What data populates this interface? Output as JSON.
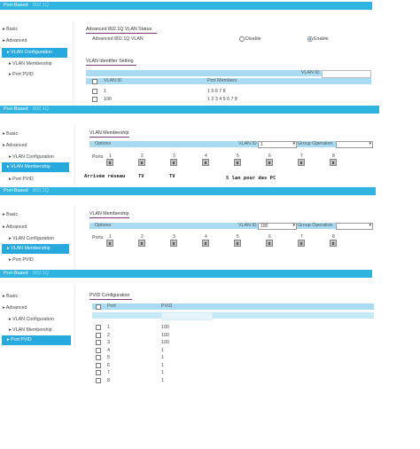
{
  "common": {
    "tab_main": "Port-Based",
    "tab_sub": "802.1Q",
    "nav_basic": "Basic",
    "nav_advanced": "Advanced",
    "nav_vlan_config": "VLAN Configuration",
    "nav_vlan_membership": "VLAN Membership",
    "nav_port_pvid": "Port PVID",
    "bullet": "▸"
  },
  "panel1": {
    "status_title": "Advanced 802.1Q VLAN Status",
    "status_label": "Advanced 802.1Q VLAN",
    "disable_label": "Disable",
    "enable_label": "Enable",
    "selected": "Enable",
    "id_setting_title": "VLAN Identifier Setting",
    "vlan_id_label": "VLAN ID",
    "col_vlan_id": "VLAN ID",
    "col_port_members": "Port Members",
    "rows": [
      {
        "id": "1",
        "members": "1   5 6 7 8"
      },
      {
        "id": "100",
        "members": "1 2 3 4 5 6 7 8"
      }
    ]
  },
  "membership": {
    "title": "VLAN Membership",
    "options_label": "Options",
    "vlan_id_label": "VLAN ID",
    "group_op_label": "Group Operation",
    "ports_label": "Ports",
    "port_numbers": [
      "1",
      "2",
      "3",
      "4",
      "5",
      "6",
      "7",
      "8"
    ]
  },
  "panel2": {
    "vlan_id_value": "1",
    "port_states": [
      "T",
      "U",
      "U",
      "U",
      "U",
      "U",
      "U",
      "U"
    ],
    "annotations": {
      "a1": "Arrivée réseau",
      "a2": "TV",
      "a3": "TV",
      "a4": "5 lan pour des PC"
    }
  },
  "panel3": {
    "vlan_id_value": "100",
    "port_states": [
      "T",
      "T",
      "T",
      "T",
      "T",
      "T",
      "T",
      "T"
    ]
  },
  "pvid": {
    "title": "PVID Configuration",
    "col_port": "Port",
    "col_pvid": "PVID",
    "rows": [
      {
        "port": "1",
        "pvid": "100"
      },
      {
        "port": "2",
        "pvid": "100"
      },
      {
        "port": "3",
        "pvid": "100"
      },
      {
        "port": "4",
        "pvid": "1"
      },
      {
        "port": "5",
        "pvid": "1"
      },
      {
        "port": "6",
        "pvid": "1"
      },
      {
        "port": "7",
        "pvid": "1"
      },
      {
        "port": "8",
        "pvid": "1"
      }
    ]
  }
}
